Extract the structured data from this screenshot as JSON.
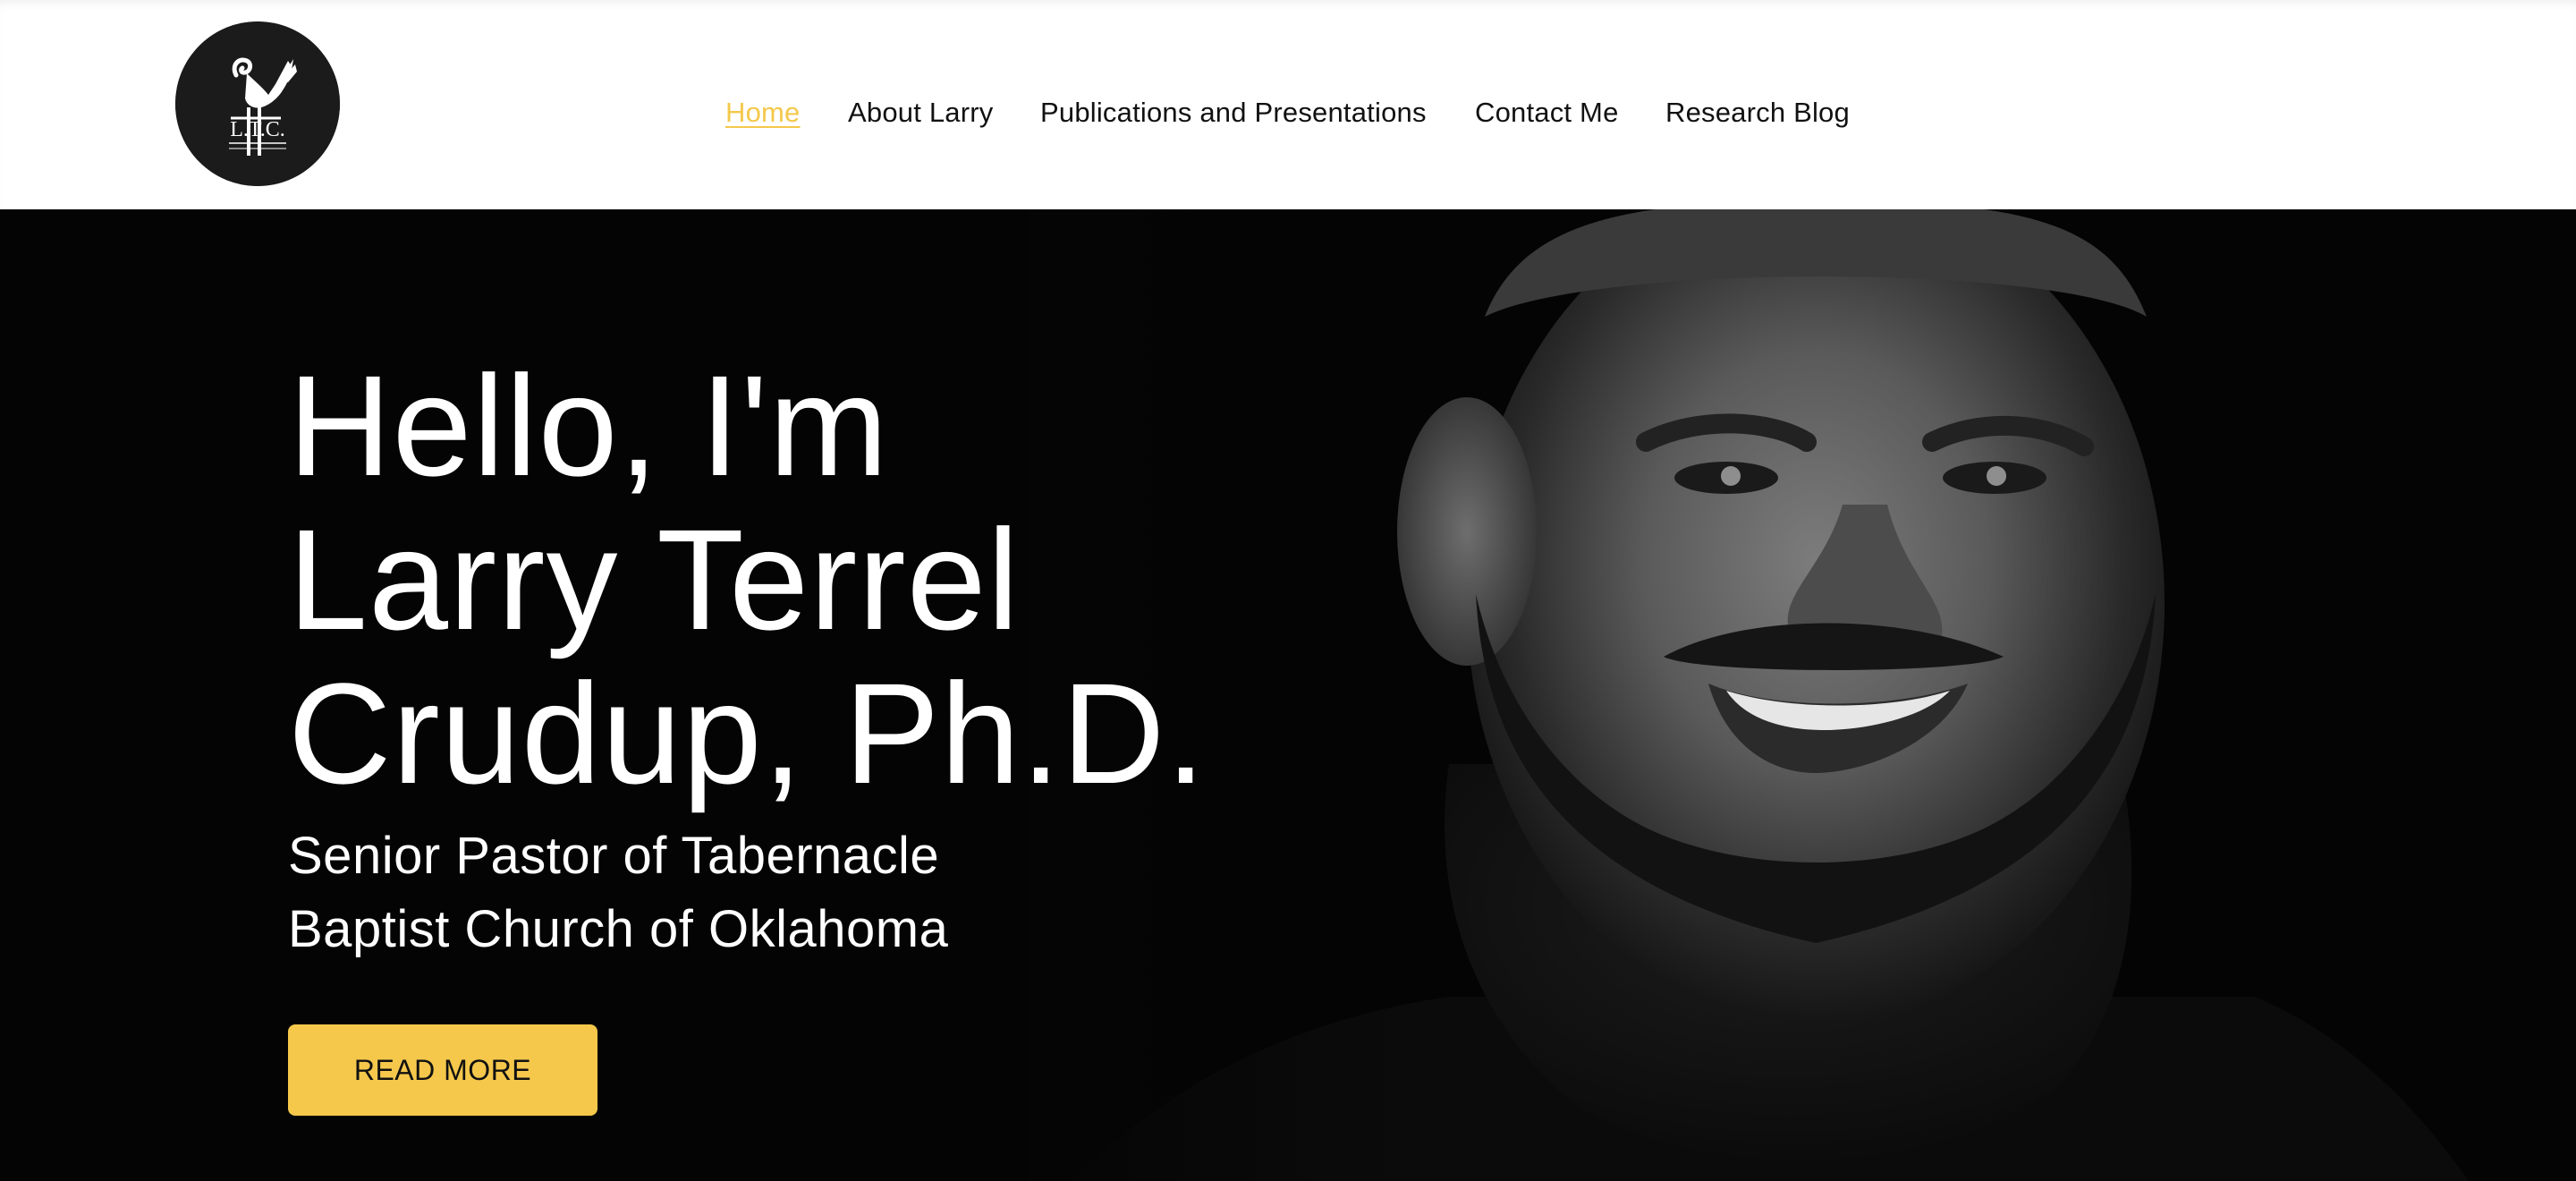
{
  "header": {
    "logo_text": "L.T.C.",
    "nav": [
      {
        "label": "Home",
        "active": true
      },
      {
        "label": "About Larry",
        "active": false
      },
      {
        "label": "Publications and Presentations",
        "active": false
      },
      {
        "label": "Contact Me",
        "active": false
      },
      {
        "label": "Research Blog",
        "active": false
      }
    ]
  },
  "hero": {
    "heading_lines": [
      "Hello, I'm",
      "Larry Terrel",
      "Crudup, Ph.D."
    ],
    "subtitle_lines": [
      "Senior Pastor of Tabernacle",
      "Baptist Church of Oklahoma"
    ],
    "cta_label": "READ MORE",
    "photo_icon": "portrait-photo"
  },
  "colors": {
    "accent": "#f5c84c",
    "nav_active": "#f4c84b",
    "header_bg": "#ffffff",
    "hero_bg": "#040404",
    "logo_bg": "#1c1b1b"
  }
}
